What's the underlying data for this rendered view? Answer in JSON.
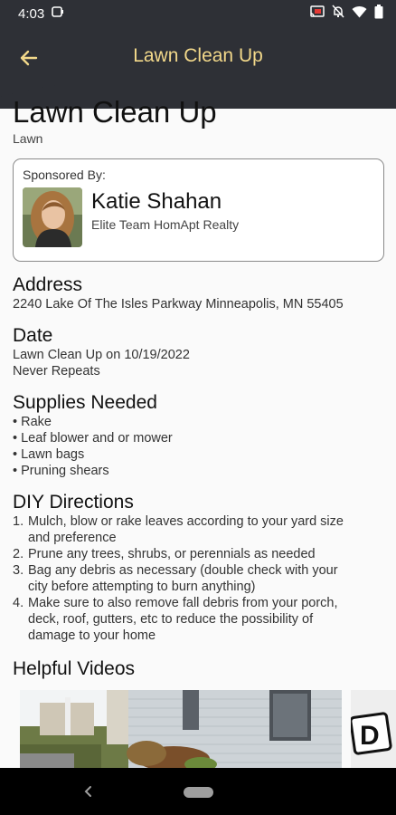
{
  "status_bar": {
    "time": "4:03",
    "icons": [
      "notification-icon",
      "cast-icon",
      "mute-icon",
      "wifi-icon",
      "battery-icon"
    ]
  },
  "app_bar": {
    "title": "Lawn Clean Up",
    "back_icon": "arrow-left-icon",
    "title_color": "#f2d88a",
    "background": "#2e3036"
  },
  "task": {
    "title": "Lawn Clean Up",
    "category": "Lawn"
  },
  "sponsor": {
    "label": "Sponsored By:",
    "name": "Katie Shahan",
    "company": "Elite Team HomApt Realty"
  },
  "address": {
    "title": "Address",
    "value": "2240 Lake Of The Isles Parkway Minneapolis, MN 55405"
  },
  "date": {
    "title": "Date",
    "line1": "Lawn Clean Up on 10/19/2022",
    "line2": "Never Repeats"
  },
  "supplies": {
    "title": "Supplies Needed",
    "items": [
      "• Rake",
      "• Leaf blower and or mower",
      "• Lawn bags",
      "• Pruning shears"
    ]
  },
  "directions": {
    "title": "DIY Directions",
    "items": [
      {
        "num": "1.",
        "lines": [
          "Mulch, blow or rake leaves according to your yard size",
          "and preference"
        ]
      },
      {
        "num": "2.",
        "lines": [
          "Prune any trees, shrubs, or perennials as needed"
        ]
      },
      {
        "num": "3.",
        "lines": [
          "Bag any debris as necessary (double check with your",
          "city before attempting to burn anything)"
        ]
      },
      {
        "num": "4.",
        "lines": [
          "Make sure to also remove fall debris from your porch,",
          "deck, roof, gutters, etc to reduce the possibility of",
          "damage to your home"
        ]
      }
    ]
  },
  "videos": {
    "title": "Helpful Videos"
  }
}
